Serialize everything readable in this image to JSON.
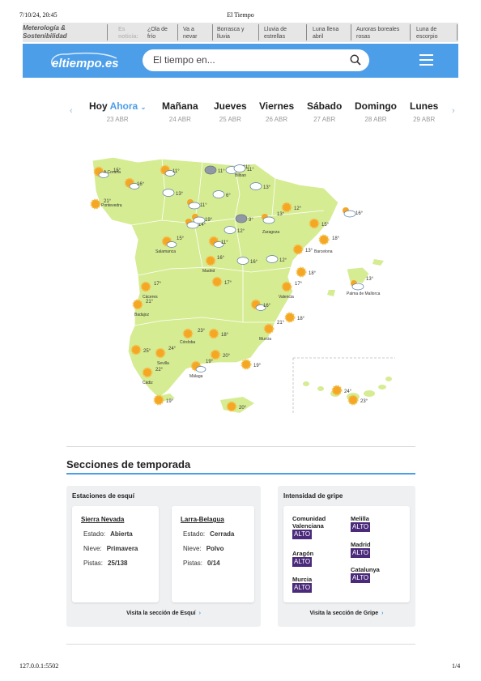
{
  "print_header": {
    "datetime": "7/10/24, 20:45",
    "title": "El Tiempo"
  },
  "trending": {
    "lead": "Meterología & Sostenibilidad",
    "label": "Es noticia:",
    "items": [
      "¿Ola de frío",
      "Va a nevar",
      "Borrasca y lluvia",
      "Lluvia de estrellas",
      "Luna llena abril",
      "Auroras boreales rosas",
      "Luna de escorpio"
    ]
  },
  "header": {
    "logo": "eltiempo.es",
    "search_placeholder": "El tiempo en...",
    "colors": {
      "brand": "#4d9ee8"
    }
  },
  "days": [
    {
      "name": "Hoy",
      "extra": "Ahora",
      "date": "23 ABR"
    },
    {
      "name": "Mañana",
      "date": "24 ABR"
    },
    {
      "name": "Jueves",
      "date": "25 ABR"
    },
    {
      "name": "Viernes",
      "date": "26 ABR"
    },
    {
      "name": "Sábado",
      "date": "27 ABR"
    },
    {
      "name": "Domingo",
      "date": "28 ABR"
    },
    {
      "name": "Lunes",
      "date": "29 ABR"
    }
  ],
  "map": {
    "cities": [
      {
        "name": "A Coruña",
        "temp": "15°",
        "icon": "sun-cloud"
      },
      {
        "name": "Pontevedra",
        "temp": "21°",
        "icon": "sun"
      },
      {
        "name": "Bilbao",
        "temp": "11°",
        "icon": "cloud"
      },
      {
        "name": "Zaragoza",
        "temp": "13°",
        "icon": "cloud-sun"
      },
      {
        "name": "Barcelona",
        "temp": "18°",
        "icon": "sun"
      },
      {
        "name": "Salamanca",
        "temp": "15°",
        "icon": "sun-cloud"
      },
      {
        "name": "Madrid",
        "temp": "16°",
        "icon": "sun"
      },
      {
        "name": "Cáceres",
        "temp": "17°",
        "icon": "sun"
      },
      {
        "name": "Badajoz",
        "temp": "21°",
        "icon": "sun"
      },
      {
        "name": "Valencia",
        "temp": "17°",
        "icon": "sun"
      },
      {
        "name": "Palma de Mallorca",
        "temp": "13°",
        "icon": "cloud-sun"
      },
      {
        "name": "Córdoba",
        "temp": "23°",
        "icon": "sun"
      },
      {
        "name": "Sevilla",
        "temp": "24°",
        "icon": "sun"
      },
      {
        "name": "Murcia",
        "temp": "21°",
        "icon": "sun"
      },
      {
        "name": "Málaga",
        "temp": "19°",
        "icon": "sun-cloud"
      },
      {
        "name": "Cádiz",
        "temp": "22°",
        "icon": "sun"
      }
    ],
    "extra_temps": [
      "11°",
      "11°",
      "16°",
      "13°",
      "11°",
      "6°",
      "11°",
      "13°",
      "12°",
      "14°",
      "12°",
      "9°",
      "16°",
      "11°",
      "16°",
      "12°",
      "15°",
      "13°",
      "19°",
      "18°",
      "17°",
      "16°",
      "18°",
      "25°",
      "20°",
      "19°",
      "18°",
      "19°",
      "20°",
      "24°",
      "23°"
    ]
  },
  "sections": {
    "title": "Secciones de temporada",
    "ski": {
      "header": "Estaciones de esquí",
      "stations": [
        {
          "name": "Sierra Nevada",
          "estado_label": "Estado:",
          "estado": "Abierta",
          "nieve_label": "Nieve:",
          "nieve": "Primavera",
          "pistas_label": "Pistas:",
          "pistas": "25/138"
        },
        {
          "name": "Larra-Belagua",
          "estado_label": "Estado:",
          "estado": "Cerrada",
          "nieve_label": "Nieve:",
          "nieve": "Polvo",
          "pistas_label": "Pistas:",
          "pistas": "0/14"
        }
      ],
      "link": "Visita la sección de Esquí"
    },
    "flu": {
      "header": "Intensidad de gripe",
      "regions": [
        {
          "name": "Comunidad Valenciana",
          "level": "ALTO"
        },
        {
          "name": "Melilla",
          "level": "ALTO"
        },
        {
          "name": "Aragón",
          "level": "ALTO"
        },
        {
          "name": "Madrid",
          "level": "ALTO"
        },
        {
          "name": "Murcia",
          "level": "ALTO"
        },
        {
          "name": "Catalunya",
          "level": "ALTO"
        }
      ],
      "link": "Visita la sección de Gripe",
      "colors": {
        "alto": "#4b2a7b"
      }
    }
  },
  "footer": {
    "url": "127.0.0.1:5502",
    "page": "1/4"
  }
}
